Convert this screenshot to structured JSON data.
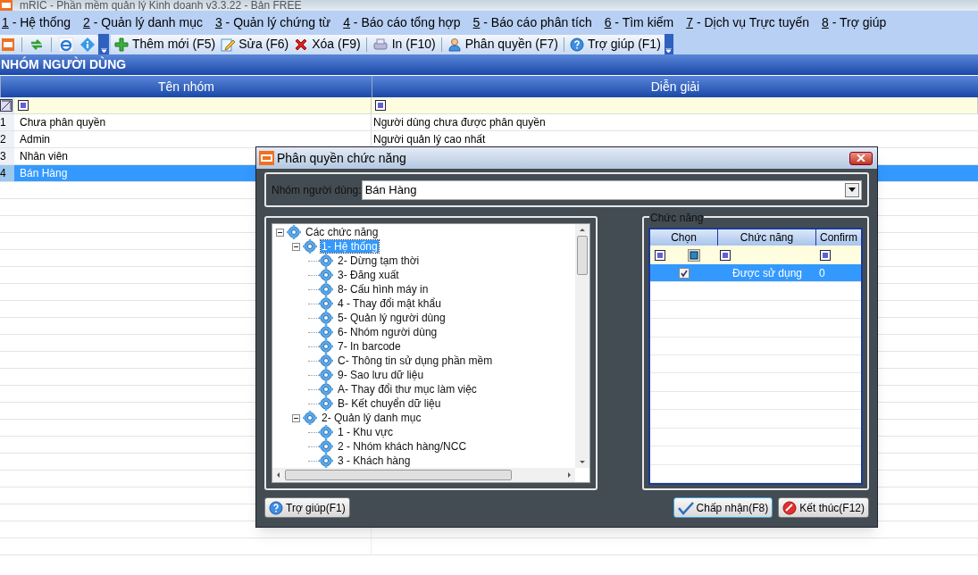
{
  "window": {
    "title": "mRIC - Phần mềm quản lý Kinh doanh v3.3.22 - Bản FREE"
  },
  "menu": [
    {
      "key": "1",
      "label": " - Hệ thống"
    },
    {
      "key": "2",
      "label": " - Quản lý danh mục"
    },
    {
      "key": "3",
      "label": " - Quản lý chứng từ"
    },
    {
      "key": "4",
      "label": " - Báo cáo tổng hợp"
    },
    {
      "key": "5",
      "label": " - Báo cáo phân tích"
    },
    {
      "key": "6",
      "label": " - Tìm kiếm"
    },
    {
      "key": "7",
      "label": " - Dịch vụ Trực tuyến"
    },
    {
      "key": "8",
      "label": " - Trợ giúp"
    }
  ],
  "toolbar": [
    {
      "kind": "add",
      "label": "Thêm mới (F5)"
    },
    {
      "kind": "edit",
      "label": "Sửa (F6)"
    },
    {
      "kind": "delete",
      "label": "Xóa (F9)"
    },
    {
      "kind": "print",
      "label": "In (F10)"
    },
    {
      "kind": "user",
      "label": "Phân quyền (F7)"
    },
    {
      "kind": "help",
      "label": "Trợ giúp (F1)"
    }
  ],
  "section_title": "NHÓM NGƯỜI DÙNG",
  "table": {
    "columns": [
      "Tên nhóm",
      "Diễn giải"
    ],
    "rows": [
      {
        "number": "1",
        "name": "Chưa phân quyền",
        "description": "Người dùng chưa được phân quyền",
        "selected": false
      },
      {
        "number": "2",
        "name": "Admin",
        "description": "Người quản lý cao nhất",
        "selected": false
      },
      {
        "number": "3",
        "name": "Nhân viên",
        "selected": false
      },
      {
        "number": "4",
        "name": "Bán Hàng",
        "selected": true
      }
    ]
  },
  "dialog": {
    "title": "Phân quyền chức năng",
    "group_label": "Nhóm người dùng:",
    "group_value": "Bán Hàng",
    "tree": [
      {
        "label": "Các chức năng",
        "expanded": true,
        "selected": false,
        "children": [
          {
            "label": "1- Hệ thống",
            "expanded": true,
            "selected": true,
            "children": [
              {
                "label": "2- Dừng tạm thời",
                "selected": false
              },
              {
                "label": "3- Đăng xuất",
                "selected": false
              },
              {
                "label": "8- Cấu hình máy in",
                "selected": false
              },
              {
                "label": "4 - Thay đổi mật khẩu",
                "selected": false
              },
              {
                "label": "5- Quản lý người dùng",
                "selected": false
              },
              {
                "label": "6- Nhóm người dùng",
                "selected": false
              },
              {
                "label": "7- In barcode",
                "selected": false
              },
              {
                "label": "C- Thông tin sử dụng phần mềm",
                "selected": false
              },
              {
                "label": "9- Sao lưu dữ liệu",
                "selected": false
              },
              {
                "label": "A- Thay đổi thư mục làm việc",
                "selected": false
              },
              {
                "label": "B- Kết chuyển dữ liệu",
                "selected": false
              }
            ]
          },
          {
            "label": "2- Quản lý danh mục",
            "expanded": true,
            "selected": false,
            "children": [
              {
                "label": "1 - Khu vực",
                "selected": false
              },
              {
                "label": "2 - Nhóm khách hàng/NCC",
                "selected": false
              },
              {
                "label": "3 - Khách hàng",
                "selected": false
              }
            ]
          }
        ]
      }
    ],
    "functions_title": "Chức năng",
    "functions_columns": [
      "Chọn",
      "Chức năng",
      "Confirm"
    ],
    "functions_rows": [
      {
        "checked": true,
        "name": "Được sử dụng",
        "confirm": "0",
        "selected": true
      }
    ],
    "buttons": [
      {
        "kind": "help",
        "label": "Trợ giúp(F1)"
      },
      {
        "kind": "accept",
        "label": "Chấp nhận(F8)"
      },
      {
        "kind": "cancel",
        "label": "Kết thúc(F12)"
      }
    ]
  }
}
